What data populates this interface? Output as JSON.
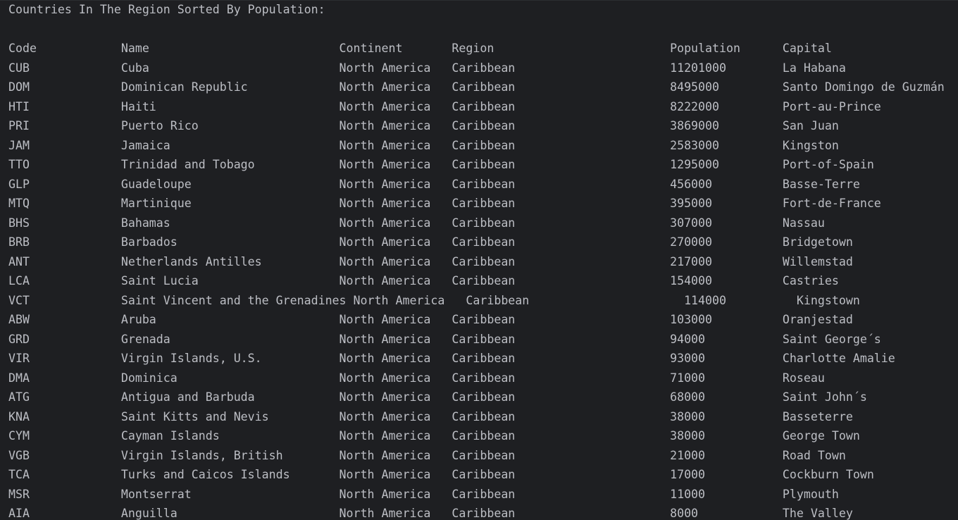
{
  "console": {
    "title": "Countries In The Region Sorted By Population:",
    "header_line": "Code            Name                           Continent       Region                         Population      Capital",
    "rows": [
      "CUB             Cuba                           North America   Caribbean                      11201000        La Habana",
      "DOM             Dominican Republic             North America   Caribbean                      8495000         Santo Domingo de Guzmán",
      "HTI             Haiti                          North America   Caribbean                      8222000         Port-au-Prince",
      "PRI             Puerto Rico                    North America   Caribbean                      3869000         San Juan",
      "JAM             Jamaica                        North America   Caribbean                      2583000         Kingston",
      "TTO             Trinidad and Tobago            North America   Caribbean                      1295000         Port-of-Spain",
      "GLP             Guadeloupe                     North America   Caribbean                      456000          Basse-Terre",
      "MTQ             Martinique                     North America   Caribbean                      395000          Fort-de-France",
      "BHS             Bahamas                        North America   Caribbean                      307000          Nassau",
      "BRB             Barbados                       North America   Caribbean                      270000          Bridgetown",
      "ANT             Netherlands Antilles           North America   Caribbean                      217000          Willemstad",
      "LCA             Saint Lucia                    North America   Caribbean                      154000          Castries",
      "VCT             Saint Vincent and the Grenadines North America   Caribbean                      114000          Kingstown",
      "ABW             Aruba                          North America   Caribbean                      103000          Oranjestad",
      "GRD             Grenada                        North America   Caribbean                      94000           Saint George´s",
      "VIR             Virgin Islands, U.S.           North America   Caribbean                      93000           Charlotte Amalie",
      "DMA             Dominica                       North America   Caribbean                      71000           Roseau",
      "ATG             Antigua and Barbuda            North America   Caribbean                      68000           Saint John´s",
      "KNA             Saint Kitts and Nevis          North America   Caribbean                      38000           Basseterre",
      "CYM             Cayman Islands                 North America   Caribbean                      38000           George Town",
      "VGB             Virgin Islands, British        North America   Caribbean                      21000           Road Town",
      "TCA             Turks and Caicos Islands       North America   Caribbean                      17000           Cockburn Town",
      "MSR             Montserrat                     North America   Caribbean                      11000           Plymouth",
      "AIA             Anguilla                       North America   Caribbean                      8000            The Valley"
    ]
  }
}
